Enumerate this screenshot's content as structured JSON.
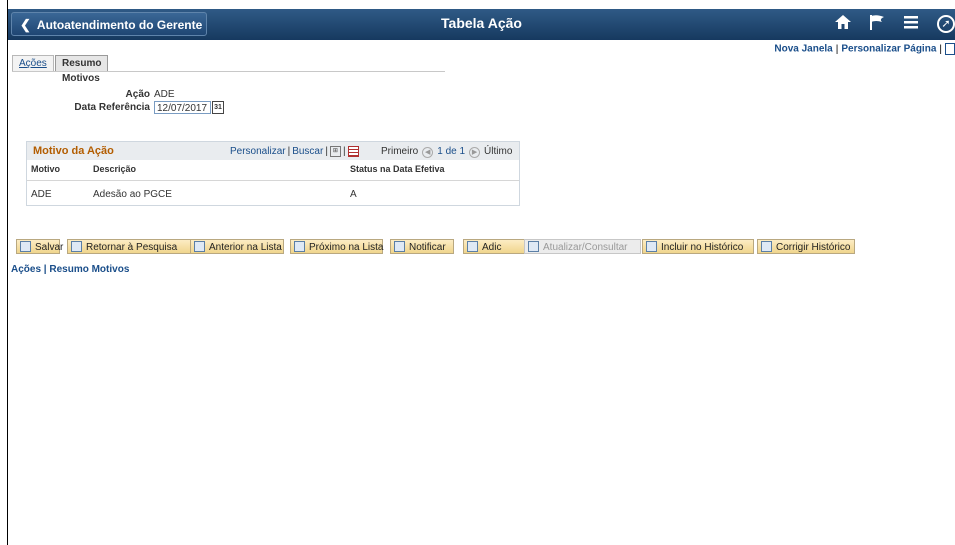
{
  "header": {
    "back_label": "Autoatendimento do Gerente",
    "title": "Tabela Ação",
    "icons": [
      "chevron-left-icon",
      "home-icon",
      "flag-icon",
      "menu-icon",
      "compass-icon"
    ]
  },
  "toplinks": {
    "new_window": "Nova Janela",
    "personalize_page": "Personalizar Página"
  },
  "tabs": [
    {
      "label": "Ações"
    },
    {
      "label": "Resumo Motivos"
    }
  ],
  "fields": {
    "acao_label": "Ação",
    "acao_value": "ADE",
    "data_ref_label": "Data Referência",
    "data_ref_value": "12/07/2017"
  },
  "grid": {
    "title": "Motivo da Ação",
    "personalize": "Personalizar",
    "find": "Buscar",
    "first": "Primeiro",
    "count": "1 de 1",
    "last": "Último",
    "columns": [
      "Motivo",
      "Descrição",
      "Status na Data Efetiva"
    ],
    "rows": [
      [
        "ADE",
        "Adesão ao PGCE",
        "A"
      ]
    ]
  },
  "toolbar": [
    {
      "label": "Salvar"
    },
    {
      "label": "Retornar à Pesquisa"
    },
    {
      "label": "Anterior na Lista"
    },
    {
      "label": "Próximo na Lista"
    },
    {
      "label": "Notificar"
    },
    {
      "label": "Adic"
    },
    {
      "label": "Atualizar/Consultar"
    },
    {
      "label": "Incluir no Histórico"
    },
    {
      "label": "Corrigir Histórico"
    }
  ],
  "bottom_links": {
    "acoes": "Ações",
    "resumo": "Resumo Motivos"
  }
}
